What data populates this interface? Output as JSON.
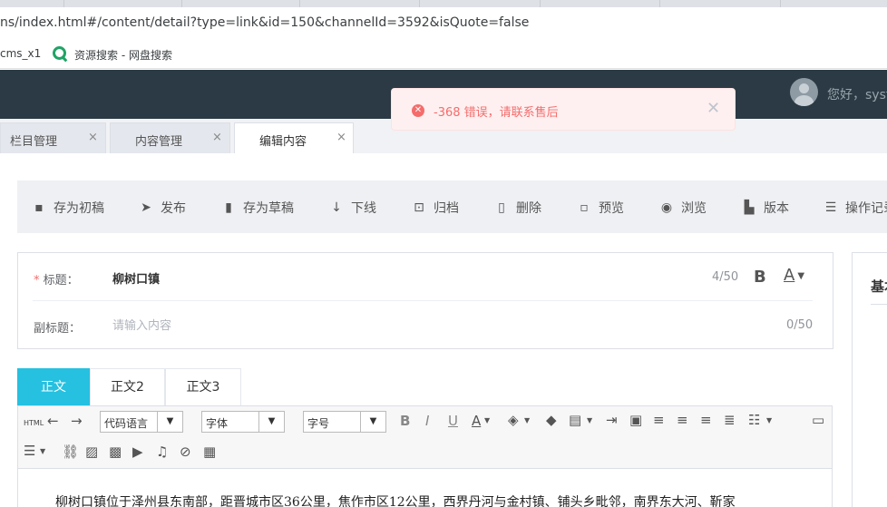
{
  "browser": {
    "url": "ns/index.html#/content/detail?type=link&id=150&channelId=3592&isQuote=false",
    "bookmarks": [
      {
        "label": "cms_x1"
      },
      {
        "label": "资源搜索 - 网盘搜索"
      }
    ]
  },
  "header": {
    "greeting": "您好，syst"
  },
  "toast": {
    "message": "-368 错误，请联系售后",
    "icon": "error-circle-icon",
    "color": "#f56c6c"
  },
  "page_tabs": [
    {
      "label": "栏目管理",
      "active": false
    },
    {
      "label": "内容管理",
      "active": false
    },
    {
      "label": "编辑内容",
      "active": true
    }
  ],
  "toolbar": {
    "items": [
      {
        "label": "存为初稿",
        "icon": "save-icon"
      },
      {
        "label": "发布",
        "icon": "send-icon"
      },
      {
        "label": "存为草稿",
        "icon": "draft-icon"
      },
      {
        "label": "下线",
        "icon": "arrow-down-icon"
      },
      {
        "label": "归档",
        "icon": "archive-icon"
      },
      {
        "label": "删除",
        "icon": "trash-icon"
      },
      {
        "label": "预览",
        "icon": "preview-icon"
      },
      {
        "label": "浏览",
        "icon": "eye-icon"
      },
      {
        "label": "版本",
        "icon": "version-icon"
      },
      {
        "label": "操作记录",
        "icon": "log-icon"
      }
    ]
  },
  "form": {
    "title_label": "标题：",
    "title_required": "*",
    "title_value": "柳树口镇",
    "title_count": "4/50",
    "subtitle_label": "副标题：",
    "subtitle_placeholder": "请输入内容",
    "subtitle_count": "0/50"
  },
  "side_panel": {
    "title": "基本"
  },
  "body_tabs": [
    {
      "label": "正文",
      "active": true
    },
    {
      "label": "正文2",
      "active": false
    },
    {
      "label": "正文3",
      "active": false
    }
  ],
  "editor": {
    "html_label": "HTML",
    "code_language": "代码语言",
    "font_family": "字体",
    "font_size": "字号",
    "content": "柳树口镇位于泽州县东南部，距晋城市区36公里，焦作市区12公里，西界丹河与金村镇、铺头乡毗邻，南界东大河、靳家"
  },
  "colors": {
    "accent": "#26c0e0",
    "header_bg": "#2b3a44",
    "error": "#f56c6c"
  }
}
